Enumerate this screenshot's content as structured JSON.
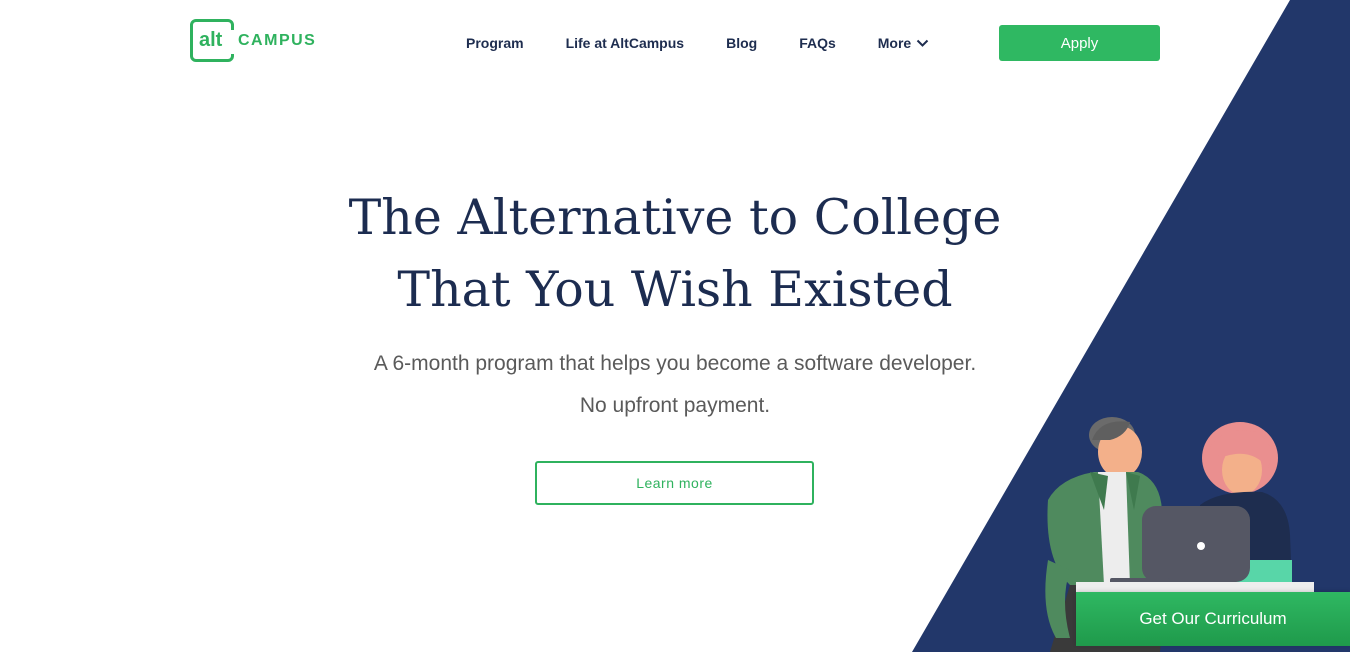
{
  "brand": {
    "logo_alt": "alt",
    "logo_campus": "CAMPUS",
    "accent_color": "#2fb25e",
    "navy_color": "#22376a"
  },
  "nav": {
    "items": [
      {
        "label": "Program"
      },
      {
        "label": "Life at AltCampus"
      },
      {
        "label": "Blog"
      },
      {
        "label": "FAQs"
      },
      {
        "label": "More",
        "icon": "chevron-down-icon"
      }
    ],
    "apply_label": "Apply"
  },
  "hero": {
    "title_line1": "The Alternative to College",
    "title_line2": "That You Wish Existed",
    "subtitle_line1": "A 6-month program that helps you become a software developer.",
    "subtitle_line2": "No upfront payment.",
    "cta_label": "Learn more"
  },
  "curriculum": {
    "label": "Get Our Curriculum"
  }
}
